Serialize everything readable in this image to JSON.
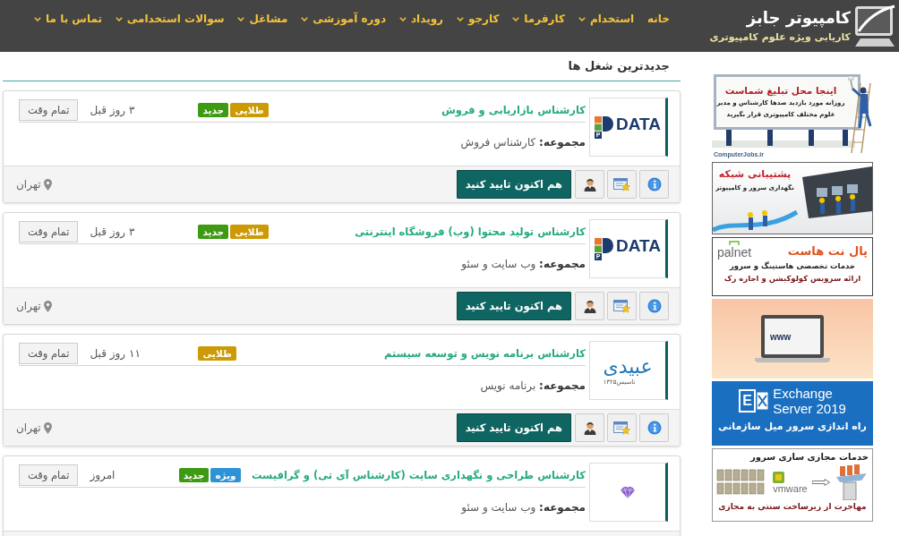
{
  "header": {
    "logo_title": "کامپیوتر جابز",
    "logo_subtitle": "کاریابی ویژه علوم کامپیوتری",
    "nav": [
      {
        "label": "خانه",
        "dropdown": false
      },
      {
        "label": "استخدام",
        "dropdown": true
      },
      {
        "label": "کارفرما",
        "dropdown": true
      },
      {
        "label": "کارجو",
        "dropdown": true
      },
      {
        "label": "رویداد",
        "dropdown": true
      },
      {
        "label": "دوره آموزشی",
        "dropdown": true
      },
      {
        "label": "مشاغل",
        "dropdown": true
      },
      {
        "label": "سوالات استخدامی",
        "dropdown": true
      },
      {
        "label": "تماس با ما",
        "dropdown": true
      }
    ]
  },
  "main": {
    "title": "جدیدترین شغل ها",
    "jobs": [
      {
        "logo": {
          "kind": "pdata",
          "letter": "P",
          "text": "DATA"
        },
        "title": "کارشناس بازاریابی و فروش",
        "badges": [
          {
            "label": "طلایی",
            "color": "#cc9a06"
          },
          {
            "label": "جدید",
            "color": "#3d9a12"
          }
        ],
        "posted": "۳ روز قبل",
        "type": "تمام وقت",
        "category": "**مجموعه:** کارشناس فروش",
        "apply_button": "هم اکنون تایید کنید",
        "location": "تهران"
      },
      {
        "logo": {
          "kind": "pdata",
          "letter": "P",
          "text": "DATA"
        },
        "title": "کارشناس تولید محتوا (وب) فروشگاه اینترنتی",
        "badges": [
          {
            "label": "طلایی",
            "color": "#cc9a06"
          },
          {
            "label": "جدید",
            "color": "#3d9a12"
          }
        ],
        "posted": "۳ روز قبل",
        "type": "تمام وقت",
        "category": "**مجموعه:** وب سایت و سئو",
        "apply_button": "هم اکنون تایید کنید",
        "location": "تهران"
      },
      {
        "logo": {
          "kind": "wordmark",
          "text": "عبیدی",
          "tagline": "تاسیس۱۳۲۵"
        },
        "title": "کارشناس برنامه نویس و توسعه سیستم",
        "badges": [
          {
            "label": "طلایی",
            "color": "#cc9a06"
          }
        ],
        "posted": "۱۱ روز قبل",
        "type": "تمام وقت",
        "category": "**مجموعه:** برنامه نویس",
        "apply_button": "هم اکنون تایید کنید",
        "location": "تهران"
      },
      {
        "logo": {
          "kind": "gem"
        },
        "title": "کارشناس طراحی و نگهداری سایت (کارشناس آی تی) و گرافیست",
        "badges": [
          {
            "label": "ویژه",
            "color": "#2e93d6"
          },
          {
            "label": "جدید",
            "color": "#3d9a12"
          }
        ],
        "posted": "امروز",
        "type": "تمام وقت",
        "category": "**مجموعه:** وب سایت و سئو"
      }
    ]
  },
  "ads": [
    {
      "kind": "billboard",
      "headline": "اینجا محل تبلیغ شماست",
      "lines": [
        "روزانه مورد بازدید صدها کارشناس و مدیر",
        "علوم مختلف کامپیوتری قرار بگیرید"
      ],
      "footer": "ComputerJobs.ir"
    },
    {
      "kind": "network",
      "headline": "پشتیبانی شبکه",
      "lines": [
        "نگهداری سرور و کامپیوتر"
      ]
    },
    {
      "kind": "hosting",
      "brand": "palnet",
      "headline": "پال نت هاست",
      "lines": [
        "خدمات تخصصی هاستینگ و سرور",
        "ارائه سرویس کولوکیشن و اجاره رک"
      ]
    },
    {
      "kind": "laptop",
      "screen_text": "www"
    },
    {
      "kind": "exchange",
      "mark": "E",
      "product": [
        "Exchange",
        "Server 2019"
      ],
      "headline": "راه اندازی سرور میل سازمانی"
    },
    {
      "kind": "virtualization",
      "headline": "خدمات مجازی سازی سرور",
      "brand": "vmware",
      "footer": "مهاجرت از زیرساخت سنتی به مجازی"
    }
  ]
}
